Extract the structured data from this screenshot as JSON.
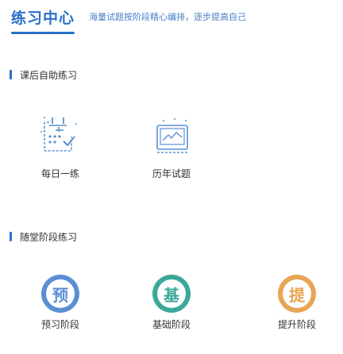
{
  "header": {
    "title": "练习中心",
    "subtitle": "海量试题按阶段精心编排，逐步提高自己"
  },
  "section_self": {
    "title": "课后自助练习",
    "tiles": [
      {
        "label": "每日一练",
        "icon": "daily-practice-icon"
      },
      {
        "label": "历年试题",
        "icon": "past-exams-icon"
      }
    ]
  },
  "section_stage": {
    "title": "随堂阶段练习",
    "tiles": [
      {
        "label": "预习阶段",
        "glyph": "预",
        "color": "#5b8fd4",
        "icon": "preview-stage-icon"
      },
      {
        "label": "基础阶段",
        "glyph": "基",
        "color": "#3aa89a",
        "icon": "basic-stage-icon"
      },
      {
        "label": "提升阶段",
        "glyph": "提",
        "color": "#e8a555",
        "icon": "advanced-stage-icon"
      }
    ]
  }
}
